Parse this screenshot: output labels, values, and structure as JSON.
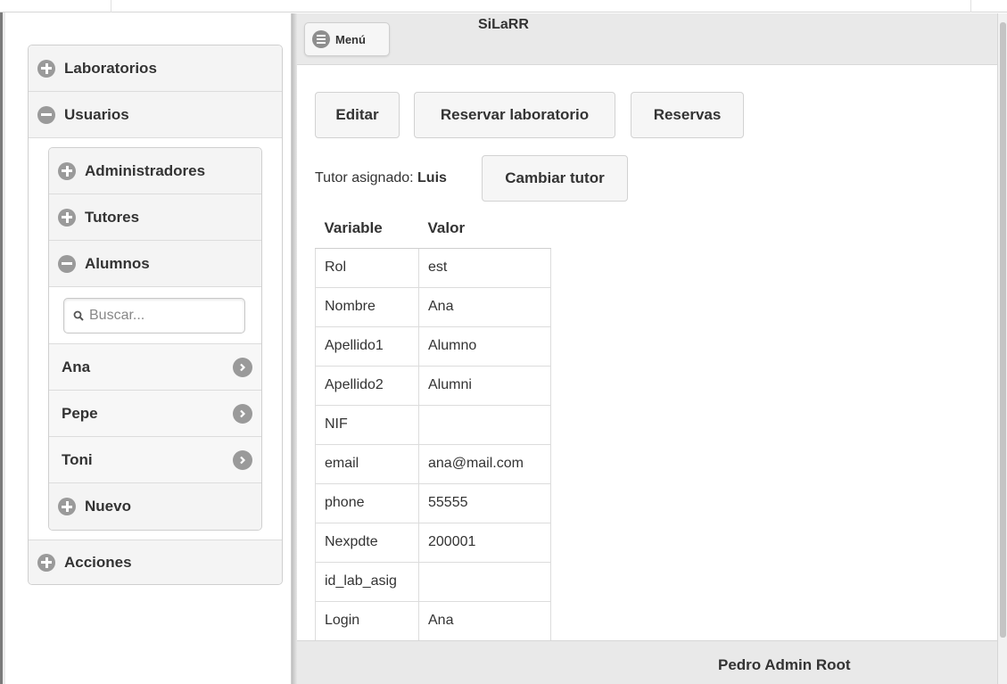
{
  "app": {
    "title": "SiLaRR",
    "menu_label": "Menú"
  },
  "sidebar": {
    "sections": [
      {
        "label": "Laboratorios",
        "icon": "plus-icon"
      },
      {
        "label": "Usuarios",
        "icon": "minus-icon"
      },
      {
        "label": "Acciones",
        "icon": "plus-icon"
      }
    ],
    "usuarios": {
      "administradores": "Administradores",
      "tutores": "Tutores",
      "alumnos": "Alumnos",
      "search_placeholder": "Buscar...",
      "students": [
        {
          "name": "Ana"
        },
        {
          "name": "Pepe"
        },
        {
          "name": "Toni"
        }
      ],
      "nuevo": "Nuevo"
    }
  },
  "actions": {
    "editar": "Editar",
    "reservar": "Reservar laboratorio",
    "reservas": "Reservas",
    "cambiar_tutor": "Cambiar tutor"
  },
  "tutor": {
    "label": "Tutor asignado: ",
    "name": "Luis"
  },
  "table": {
    "headers": [
      "Variable",
      "Valor"
    ],
    "rows": [
      [
        "Rol",
        "est"
      ],
      [
        "Nombre",
        "Ana"
      ],
      [
        "Apellido1",
        "Alumno"
      ],
      [
        "Apellido2",
        "Alumni"
      ],
      [
        "NIF",
        ""
      ],
      [
        "email",
        "ana@mail.com"
      ],
      [
        "phone",
        "55555"
      ],
      [
        "Nexpdte",
        "200001"
      ],
      [
        "id_lab_asig",
        ""
      ],
      [
        "Login",
        "Ana"
      ]
    ]
  },
  "footer": {
    "user": "Pedro Admin Root"
  },
  "colors": {
    "header_bg": "#e9e9e9",
    "icon_gray": "#9a9a9a",
    "button_bg": "#f6f6f6"
  }
}
